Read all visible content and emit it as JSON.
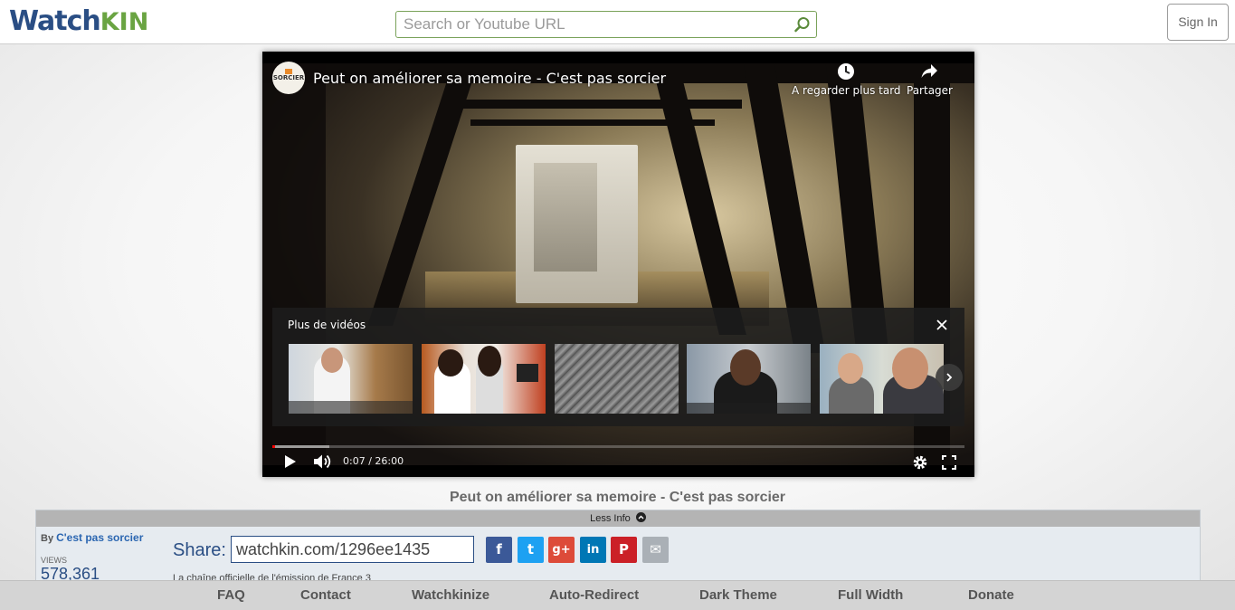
{
  "header": {
    "logo_main": "Watch",
    "logo_accent": "KIN",
    "search_placeholder": "Search or Youtube URL",
    "signin_label": "Sign In"
  },
  "player": {
    "title": "Peut on améliorer sa memoire - C'est pas sorcier",
    "channel_logo_text": "SORCIER",
    "watch_later_label": "A regarder plus tard",
    "share_label": "Partager",
    "more_videos_title": "Plus de vidéos",
    "time_display": "0:07 / 26:00",
    "progress_fraction": 0.0045,
    "buffered_fraction": 0.083
  },
  "page_title": "Peut on améliorer sa memoire - C'est pas sorcier",
  "info": {
    "toggle_label": "Less Info",
    "by_label": "By",
    "channel_name": "C'est pas sorcier",
    "views_label": "VIEWS",
    "views_value": "578,361",
    "share_label": "Share:",
    "share_url": "watchkin.com/1296ee1435",
    "description": "La chaîne officielle de l'émission de France 3",
    "social": [
      {
        "name": "facebook",
        "glyph": "f",
        "color": "#3b5998"
      },
      {
        "name": "twitter",
        "glyph": "t",
        "color": "#1da1f2"
      },
      {
        "name": "google-plus",
        "glyph": "g+",
        "color": "#dd4b39"
      },
      {
        "name": "linkedin",
        "glyph": "in",
        "color": "#0077b5"
      },
      {
        "name": "pinterest",
        "glyph": "P",
        "color": "#cb2027"
      },
      {
        "name": "email",
        "glyph": "✉",
        "color": "#aab0b6"
      }
    ]
  },
  "footer": {
    "links": [
      "FAQ",
      "Contact",
      "Watchkinize",
      "Auto-Redirect",
      "Dark Theme",
      "Full Width",
      "Donate"
    ]
  }
}
